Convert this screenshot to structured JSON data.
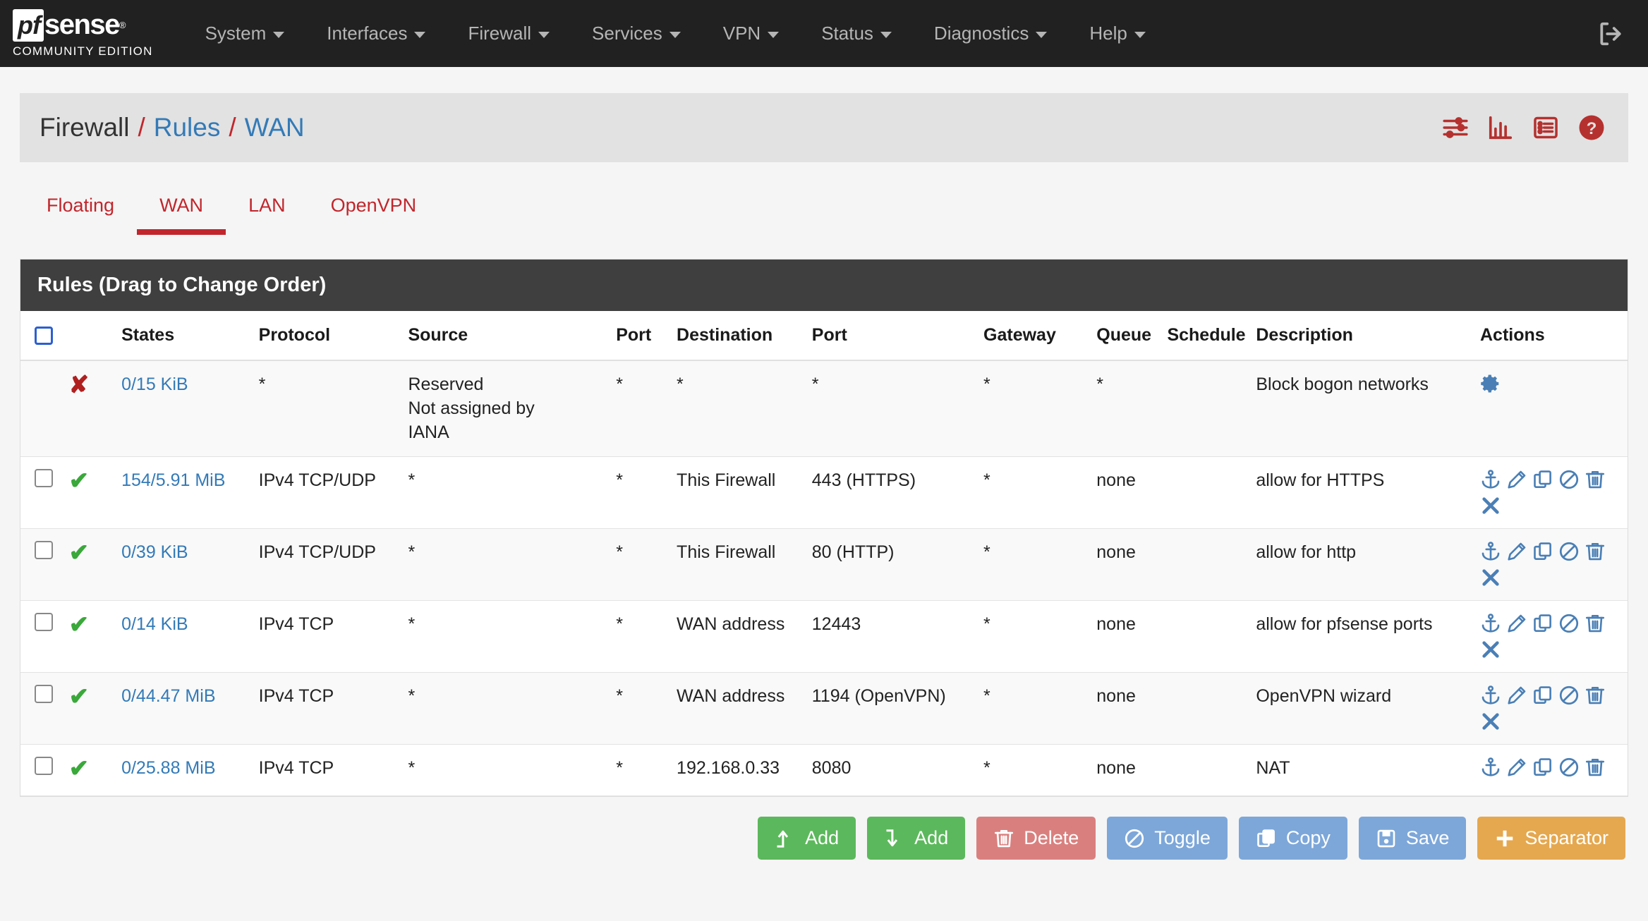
{
  "navbar": {
    "brand_name": "pfsense",
    "brand_pf": "pf",
    "brand_sense": "sense",
    "brand_subtitle": "COMMUNITY EDITION",
    "items": [
      {
        "label": "System",
        "icon": "chevron-down-icon"
      },
      {
        "label": "Interfaces",
        "icon": "chevron-down-icon"
      },
      {
        "label": "Firewall",
        "icon": "chevron-down-icon"
      },
      {
        "label": "Services",
        "icon": "chevron-down-icon"
      },
      {
        "label": "VPN",
        "icon": "chevron-down-icon"
      },
      {
        "label": "Status",
        "icon": "chevron-down-icon"
      },
      {
        "label": "Diagnostics",
        "icon": "chevron-down-icon"
      },
      {
        "label": "Help",
        "icon": "chevron-down-icon"
      }
    ],
    "logout_icon": "logout-icon"
  },
  "header": {
    "crumb1": "Firewall",
    "sep1": "/",
    "crumb2": "Rules",
    "sep2": "/",
    "crumb3": "WAN",
    "icons": [
      "sliders-icon",
      "bar-chart-icon",
      "list-icon",
      "help-circle-icon"
    ]
  },
  "tabs": [
    {
      "label": "Floating",
      "active": false
    },
    {
      "label": "WAN",
      "active": true
    },
    {
      "label": "LAN",
      "active": false
    },
    {
      "label": "OpenVPN",
      "active": false
    }
  ],
  "panel": {
    "title": "Rules (Drag to Change Order)",
    "columns": [
      "",
      "",
      "States",
      "Protocol",
      "Source",
      "Port",
      "Destination",
      "Port",
      "Gateway",
      "Queue",
      "Schedule",
      "Description",
      "Actions"
    ],
    "col_states": "States",
    "col_protocol": "Protocol",
    "col_source": "Source",
    "col_sport": "Port",
    "col_destination": "Destination",
    "col_dport": "Port",
    "col_gateway": "Gateway",
    "col_queue": "Queue",
    "col_schedule": "Schedule",
    "col_description": "Description",
    "col_actions": "Actions"
  },
  "rules": [
    {
      "checkbox": false,
      "show_checkbox": false,
      "status_icon": "block-x-icon",
      "status": "block",
      "states": "0/15 KiB",
      "protocol": "*",
      "source": "Reserved\nNot assigned by\nIANA",
      "source_port": "*",
      "destination": "*",
      "dest_port": "*",
      "gateway": "*",
      "queue": "*",
      "schedule": "",
      "description": "Block bogon networks",
      "actions": [
        "gear-icon"
      ]
    },
    {
      "checkbox": false,
      "show_checkbox": true,
      "status_icon": "pass-check-icon",
      "status": "pass",
      "states": "154/5.91 MiB",
      "protocol": "IPv4 TCP/UDP",
      "source": "*",
      "source_port": "*",
      "destination": "This Firewall",
      "dest_port": "443 (HTTPS)",
      "gateway": "*",
      "queue": "none",
      "schedule": "",
      "description": "allow for HTTPS",
      "actions": [
        "anchor-icon",
        "pencil-icon",
        "copy-icon",
        "ban-icon",
        "trash-icon",
        "x-icon"
      ]
    },
    {
      "checkbox": false,
      "show_checkbox": true,
      "status_icon": "pass-check-icon",
      "status": "pass",
      "states": "0/39 KiB",
      "protocol": "IPv4 TCP/UDP",
      "source": "*",
      "source_port": "*",
      "destination": "This Firewall",
      "dest_port": "80 (HTTP)",
      "gateway": "*",
      "queue": "none",
      "schedule": "",
      "description": "allow for http",
      "actions": [
        "anchor-icon",
        "pencil-icon",
        "copy-icon",
        "ban-icon",
        "trash-icon",
        "x-icon"
      ]
    },
    {
      "checkbox": false,
      "show_checkbox": true,
      "status_icon": "pass-check-icon",
      "status": "pass",
      "states": "0/14 KiB",
      "protocol": "IPv4 TCP",
      "source": "*",
      "source_port": "*",
      "destination": "WAN address",
      "dest_port": "12443",
      "gateway": "*",
      "queue": "none",
      "schedule": "",
      "description": "allow for pfsense ports",
      "actions": [
        "anchor-icon",
        "pencil-icon",
        "copy-icon",
        "ban-icon",
        "trash-icon",
        "x-icon"
      ]
    },
    {
      "checkbox": false,
      "show_checkbox": true,
      "status_icon": "pass-check-icon",
      "status": "pass",
      "states": "0/44.47 MiB",
      "protocol": "IPv4 TCP",
      "source": "*",
      "source_port": "*",
      "destination": "WAN address",
      "dest_port": "1194 (OpenVPN)",
      "gateway": "*",
      "queue": "none",
      "schedule": "",
      "description": "OpenVPN wizard",
      "actions": [
        "anchor-icon",
        "pencil-icon",
        "copy-icon",
        "ban-icon",
        "trash-icon",
        "x-icon"
      ]
    },
    {
      "checkbox": false,
      "show_checkbox": true,
      "status_icon": "pass-check-icon",
      "status": "pass",
      "states": "0/25.88 MiB",
      "protocol": "IPv4 TCP",
      "source": "*",
      "source_port": "*",
      "destination": "192.168.0.33",
      "dest_port": "8080",
      "gateway": "*",
      "queue": "none",
      "schedule": "",
      "description": "NAT",
      "actions": [
        "anchor-icon",
        "pencil-icon",
        "copy-icon",
        "ban-icon",
        "trash-icon"
      ]
    }
  ],
  "buttons": [
    {
      "label": "Add",
      "icon": "arrow-up-icon",
      "style": "btn-green"
    },
    {
      "label": "Add",
      "icon": "arrow-down-icon",
      "style": "btn-green"
    },
    {
      "label": "Delete",
      "icon": "trash-icon",
      "style": "btn-red"
    },
    {
      "label": "Toggle",
      "icon": "ban-icon",
      "style": "btn-blue"
    },
    {
      "label": "Copy",
      "icon": "copy-icon",
      "style": "btn-blue"
    },
    {
      "label": "Save",
      "icon": "save-icon",
      "style": "btn-blue"
    },
    {
      "label": "Separator",
      "icon": "plus-icon",
      "style": "btn-orange"
    }
  ],
  "colors": {
    "brand_dark": "#212121",
    "accent_red": "#c1262c",
    "link_blue": "#337ab7",
    "pass_green": "#3aa83a",
    "block_red": "#b0201f",
    "action_blue": "#4a7fb5",
    "btn_green": "#5cb85c",
    "btn_red": "#d9807f",
    "btn_blue": "#7da7d9",
    "btn_orange": "#e5a84f"
  }
}
